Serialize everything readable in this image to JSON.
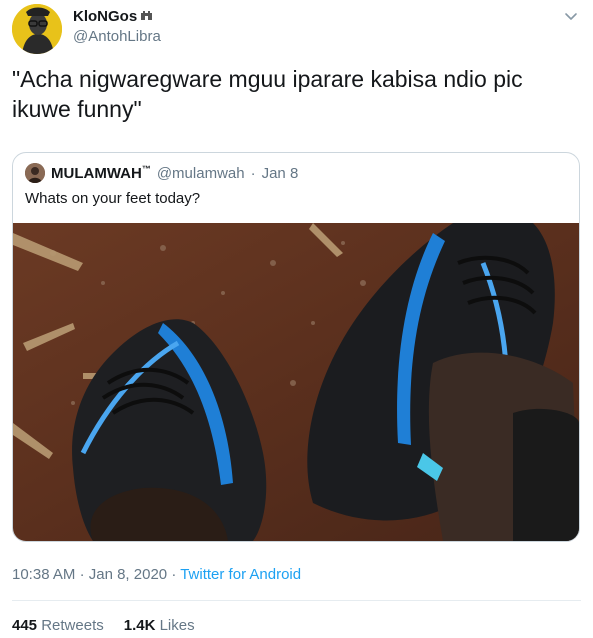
{
  "author": {
    "name": "KloNGos",
    "handle": "@AntohLibra",
    "badge_icon": "castle-emoji-icon",
    "avatar_icon": "profile-avatar-icon"
  },
  "menu_icon": "chevron-down-icon",
  "tweet": {
    "text": "\"Acha nigwaregware mguu iparare kabisa ndio pic ikuwe funny\""
  },
  "quoted": {
    "name": "MULAMWAH",
    "trademark": "™",
    "handle": "@mulamwah",
    "separator": "·",
    "date": "Jan 8",
    "text": "Whats on your feet today?",
    "photo_icon": "sneakers-photo"
  },
  "meta": {
    "time": "10:38 AM",
    "separator": "·",
    "date": "Jan 8, 2020",
    "source": "Twitter for Android"
  },
  "stats": {
    "retweets_count": "445",
    "retweets_label": "Retweets",
    "likes_count": "1.4K",
    "likes_label": "Likes"
  },
  "colors": {
    "link": "#1da1f2",
    "secondary_text": "#657786",
    "border": "#ccd6dd"
  }
}
